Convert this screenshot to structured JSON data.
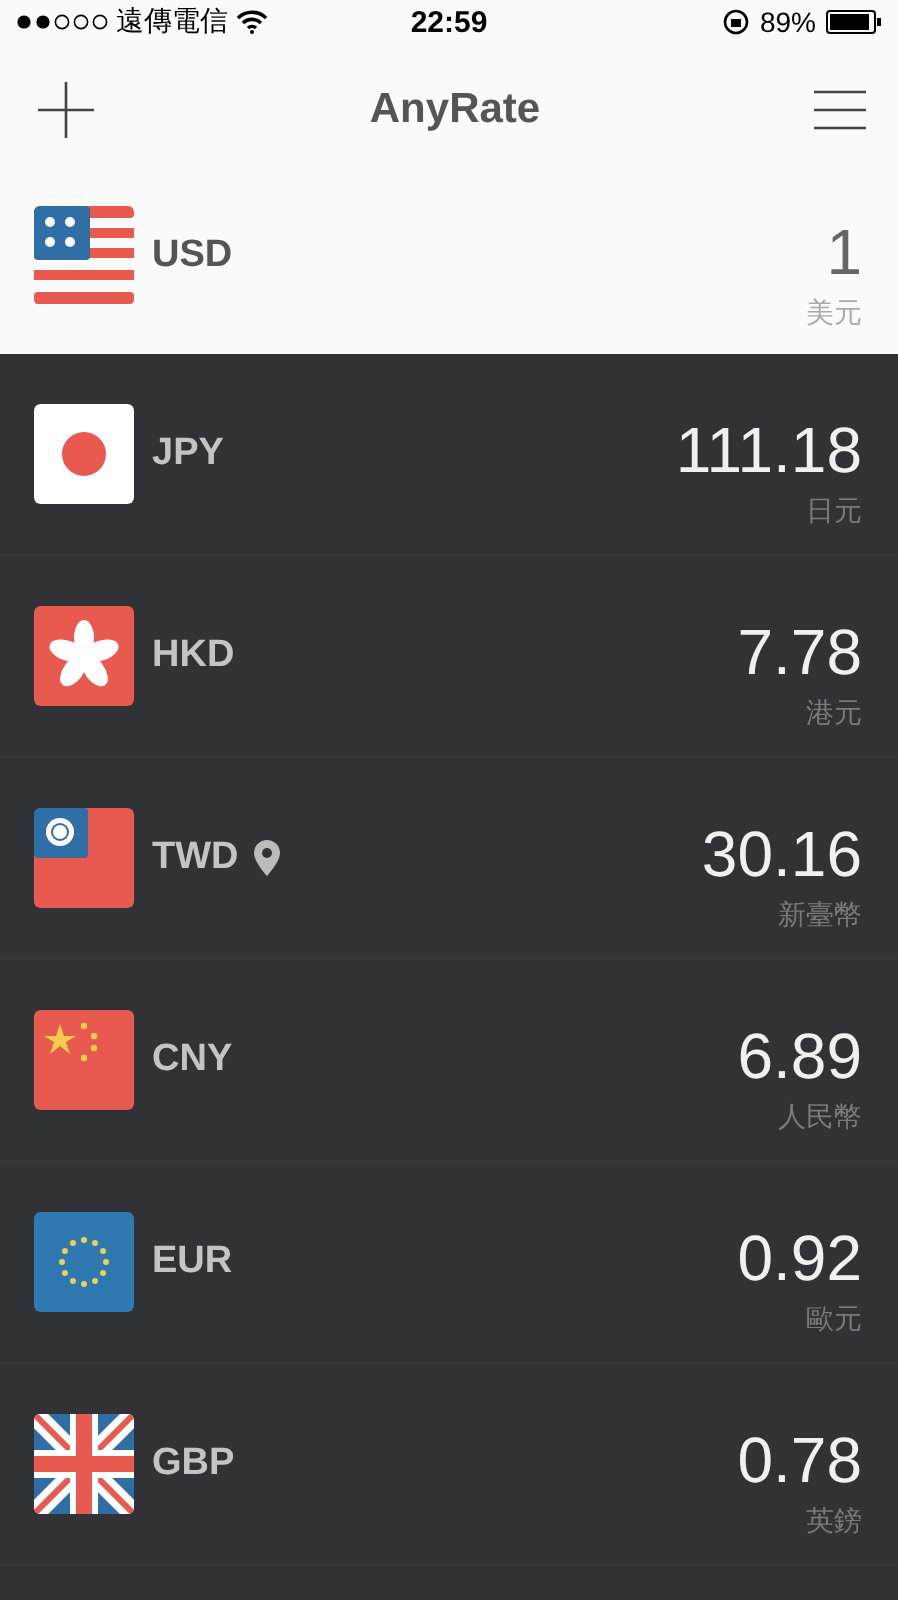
{
  "status_bar": {
    "carrier": "遠傳電信",
    "time": "22:59",
    "battery": "89%"
  },
  "header": {
    "title": "AnyRate"
  },
  "base": {
    "kind": "us",
    "code": "USD",
    "value": "1",
    "name": "美元",
    "current_location": false
  },
  "rates": [
    {
      "kind": "jp",
      "code": "JPY",
      "value": "111.18",
      "name": "日元",
      "current_location": false
    },
    {
      "kind": "hk",
      "code": "HKD",
      "value": "7.78",
      "name": "港元",
      "current_location": false
    },
    {
      "kind": "tw",
      "code": "TWD",
      "value": "30.16",
      "name": "新臺幣",
      "current_location": true
    },
    {
      "kind": "cn",
      "code": "CNY",
      "value": "6.89",
      "name": "人民幣",
      "current_location": false
    },
    {
      "kind": "eu",
      "code": "EUR",
      "value": "0.92",
      "name": "歐元",
      "current_location": false
    },
    {
      "kind": "gb",
      "code": "GBP",
      "value": "0.78",
      "name": "英鎊",
      "current_location": false
    }
  ]
}
